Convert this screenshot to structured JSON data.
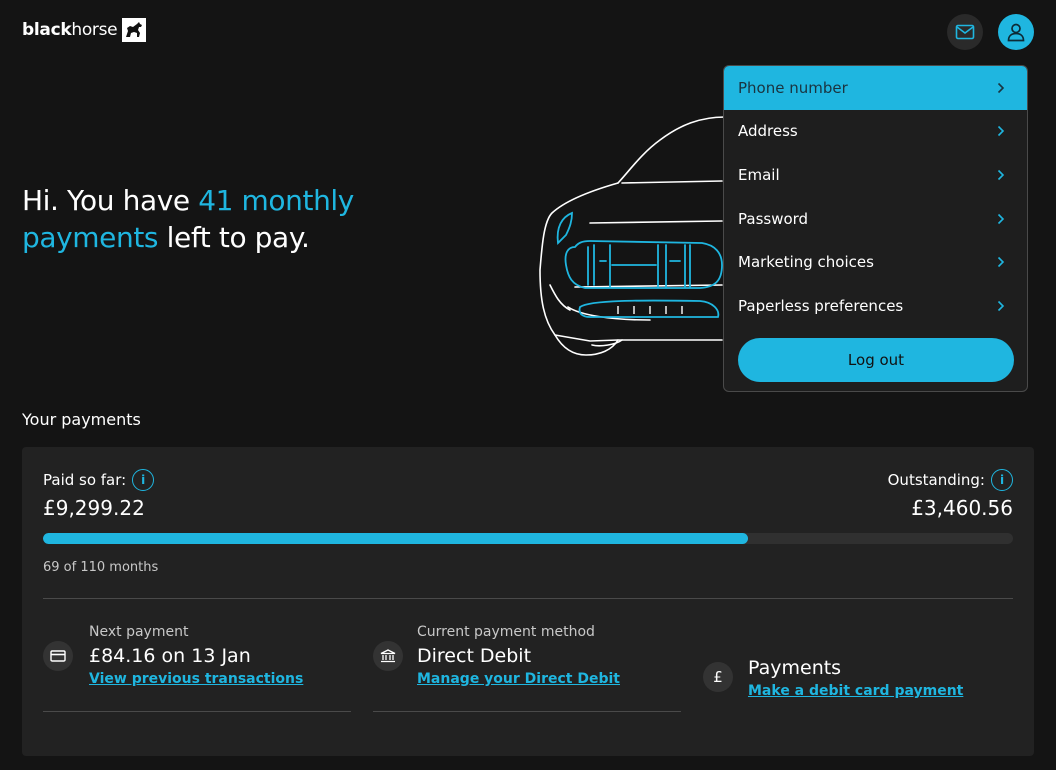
{
  "header": {
    "brand_light": "black",
    "brand_dark": "horse",
    "mail_icon": "mail-icon",
    "user_icon": "user-icon"
  },
  "hero": {
    "text_before": "Hi. You have ",
    "text_highlight": "41 monthly payments",
    "text_after": " left to pay."
  },
  "menu": {
    "items": [
      {
        "label": "Phone number",
        "active": true
      },
      {
        "label": "Address"
      },
      {
        "label": "Email"
      },
      {
        "label": "Password"
      },
      {
        "label": "Marketing choices"
      },
      {
        "label": "Paperless preferences"
      }
    ],
    "logout_label": "Log out"
  },
  "payments": {
    "section_title": "Your payments",
    "paid_label": "Paid so far:",
    "paid_amount": "£9,299.22",
    "outstanding_label": "Outstanding:",
    "outstanding_amount": "£3,460.56",
    "progress_fraction": 0.727,
    "months_text": "69 of 110 months",
    "next_payment": {
      "label": "Next payment",
      "value": "£84.16 on 13 Jan",
      "link": "View previous transactions",
      "icon": "card-icon"
    },
    "method": {
      "label": "Current payment method",
      "value": "Direct Debit",
      "link": "Manage your Direct Debit",
      "icon": "bank-icon"
    },
    "card_payment": {
      "value": "Payments",
      "link": "Make a debit card payment",
      "icon": "pound-icon"
    }
  },
  "colors": {
    "background": "#141414",
    "card": "#222222",
    "accent": "#1fb6e0"
  }
}
